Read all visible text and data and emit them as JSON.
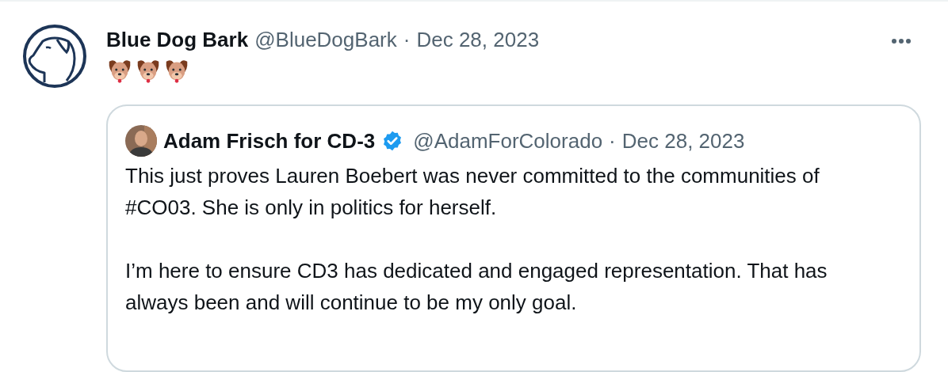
{
  "tweet": {
    "display_name": "Blue Dog Bark",
    "handle": "@BlueDogBark",
    "separator": "·",
    "date": "Dec 28, 2023",
    "quoted_tweet": {
      "display_name": "Adam Frisch for CD-3",
      "verified": true,
      "handle": "@AdamForColorado",
      "separator": "·",
      "date": "Dec 28, 2023",
      "paragraphs": [
        "This just proves Lauren Boebert was never committed to the communities of #CO03. She is only in politics for herself.",
        "I’m here to ensure CD3 has dedicated and engaged representation. That has always been and will continue to be my only goal."
      ]
    }
  }
}
